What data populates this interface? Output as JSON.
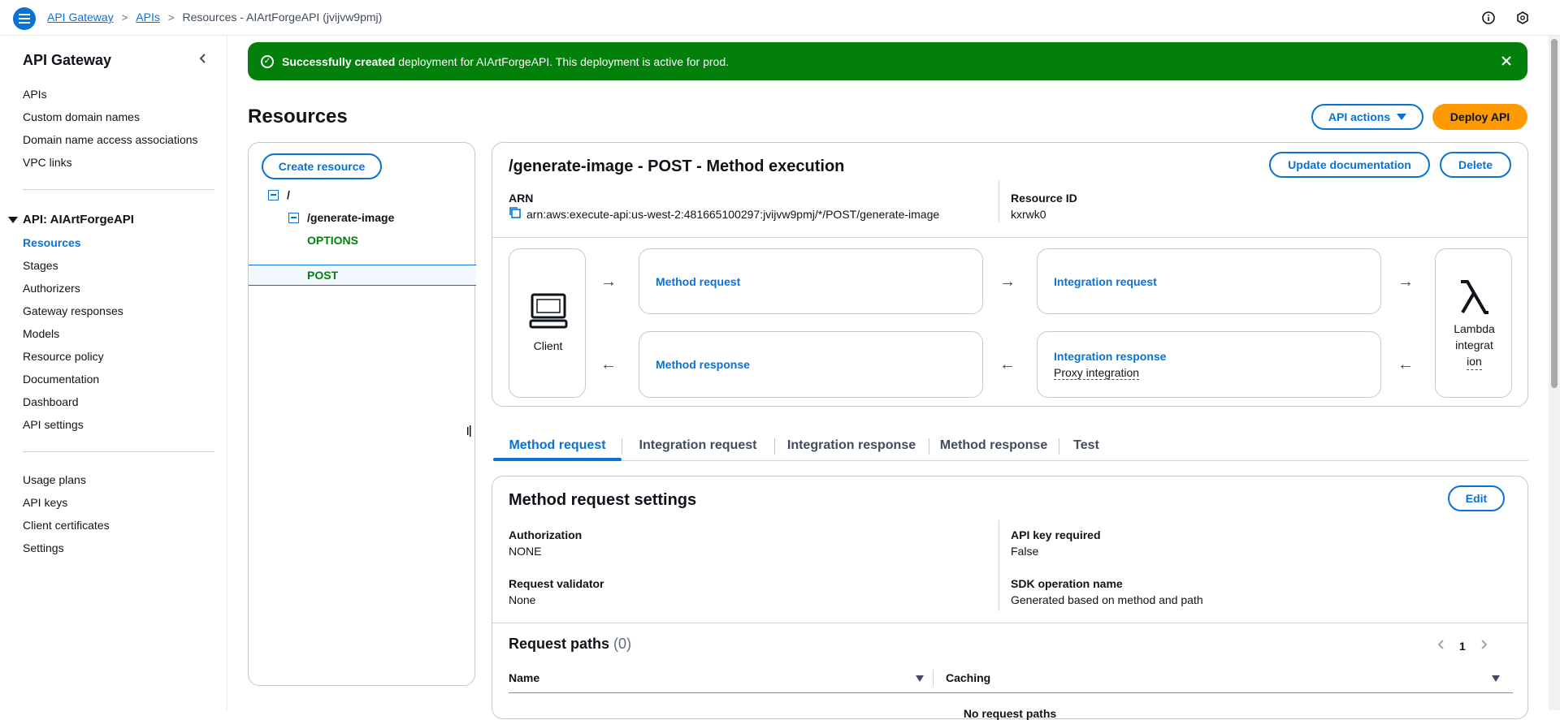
{
  "breadcrumb": {
    "home": "API Gateway",
    "apis": "APIs",
    "current": "Resources - AIArtForgeAPI (jvijvw9pmj)"
  },
  "sidebar": {
    "title": "API Gateway",
    "top_links": [
      "APIs",
      "Custom domain names",
      "Domain name access associations",
      "VPC links"
    ],
    "api_section": "API: AIArtForgeAPI",
    "api_links": [
      "Resources",
      "Stages",
      "Authorizers",
      "Gateway responses",
      "Models",
      "Resource policy",
      "Documentation",
      "Dashboard",
      "API settings"
    ],
    "bottom_links": [
      "Usage plans",
      "API keys",
      "Client certificates",
      "Settings"
    ]
  },
  "flash": {
    "strong": "Successfully created",
    "text": "deployment for AIArtForgeAPI. This deployment is active for prod."
  },
  "page": {
    "title": "Resources",
    "api_actions": "API actions",
    "deploy": "Deploy API"
  },
  "tree": {
    "create": "Create resource",
    "root": "/",
    "child": "/generate-image",
    "methods": [
      "OPTIONS",
      "POST"
    ]
  },
  "exec": {
    "title": "/generate-image - POST - Method execution",
    "update_doc": "Update documentation",
    "delete": "Delete",
    "arn_label": "ARN",
    "arn_value": "arn:aws:execute-api:us-west-2:481665100297:jvijvw9pmj/*/POST/generate-image",
    "rid_label": "Resource ID",
    "rid_value": "kxrwk0",
    "client": "Client",
    "method_request": "Method request",
    "integration_request": "Integration request",
    "method_response": "Method response",
    "integration_response": "Integration response",
    "proxy": "Proxy integration",
    "lambda_1": "Lambda",
    "lambda_2": "integrat",
    "lambda_3": "ion"
  },
  "tabs": [
    "Method request",
    "Integration request",
    "Integration response",
    "Method response",
    "Test"
  ],
  "settings": {
    "title": "Method request settings",
    "edit": "Edit",
    "auth_label": "Authorization",
    "auth_value": "NONE",
    "apikey_label": "API key required",
    "apikey_value": "False",
    "validator_label": "Request validator",
    "validator_value": "None",
    "sdk_label": "SDK operation name",
    "sdk_value": "Generated based on method and path",
    "paths_title": "Request paths",
    "paths_count": "(0)",
    "page_num": "1",
    "col_name": "Name",
    "col_caching": "Caching",
    "empty_partial": "No request paths"
  },
  "colors": {
    "primary": "#0972d3",
    "success": "#037f0c",
    "orange": "#ff9900"
  }
}
